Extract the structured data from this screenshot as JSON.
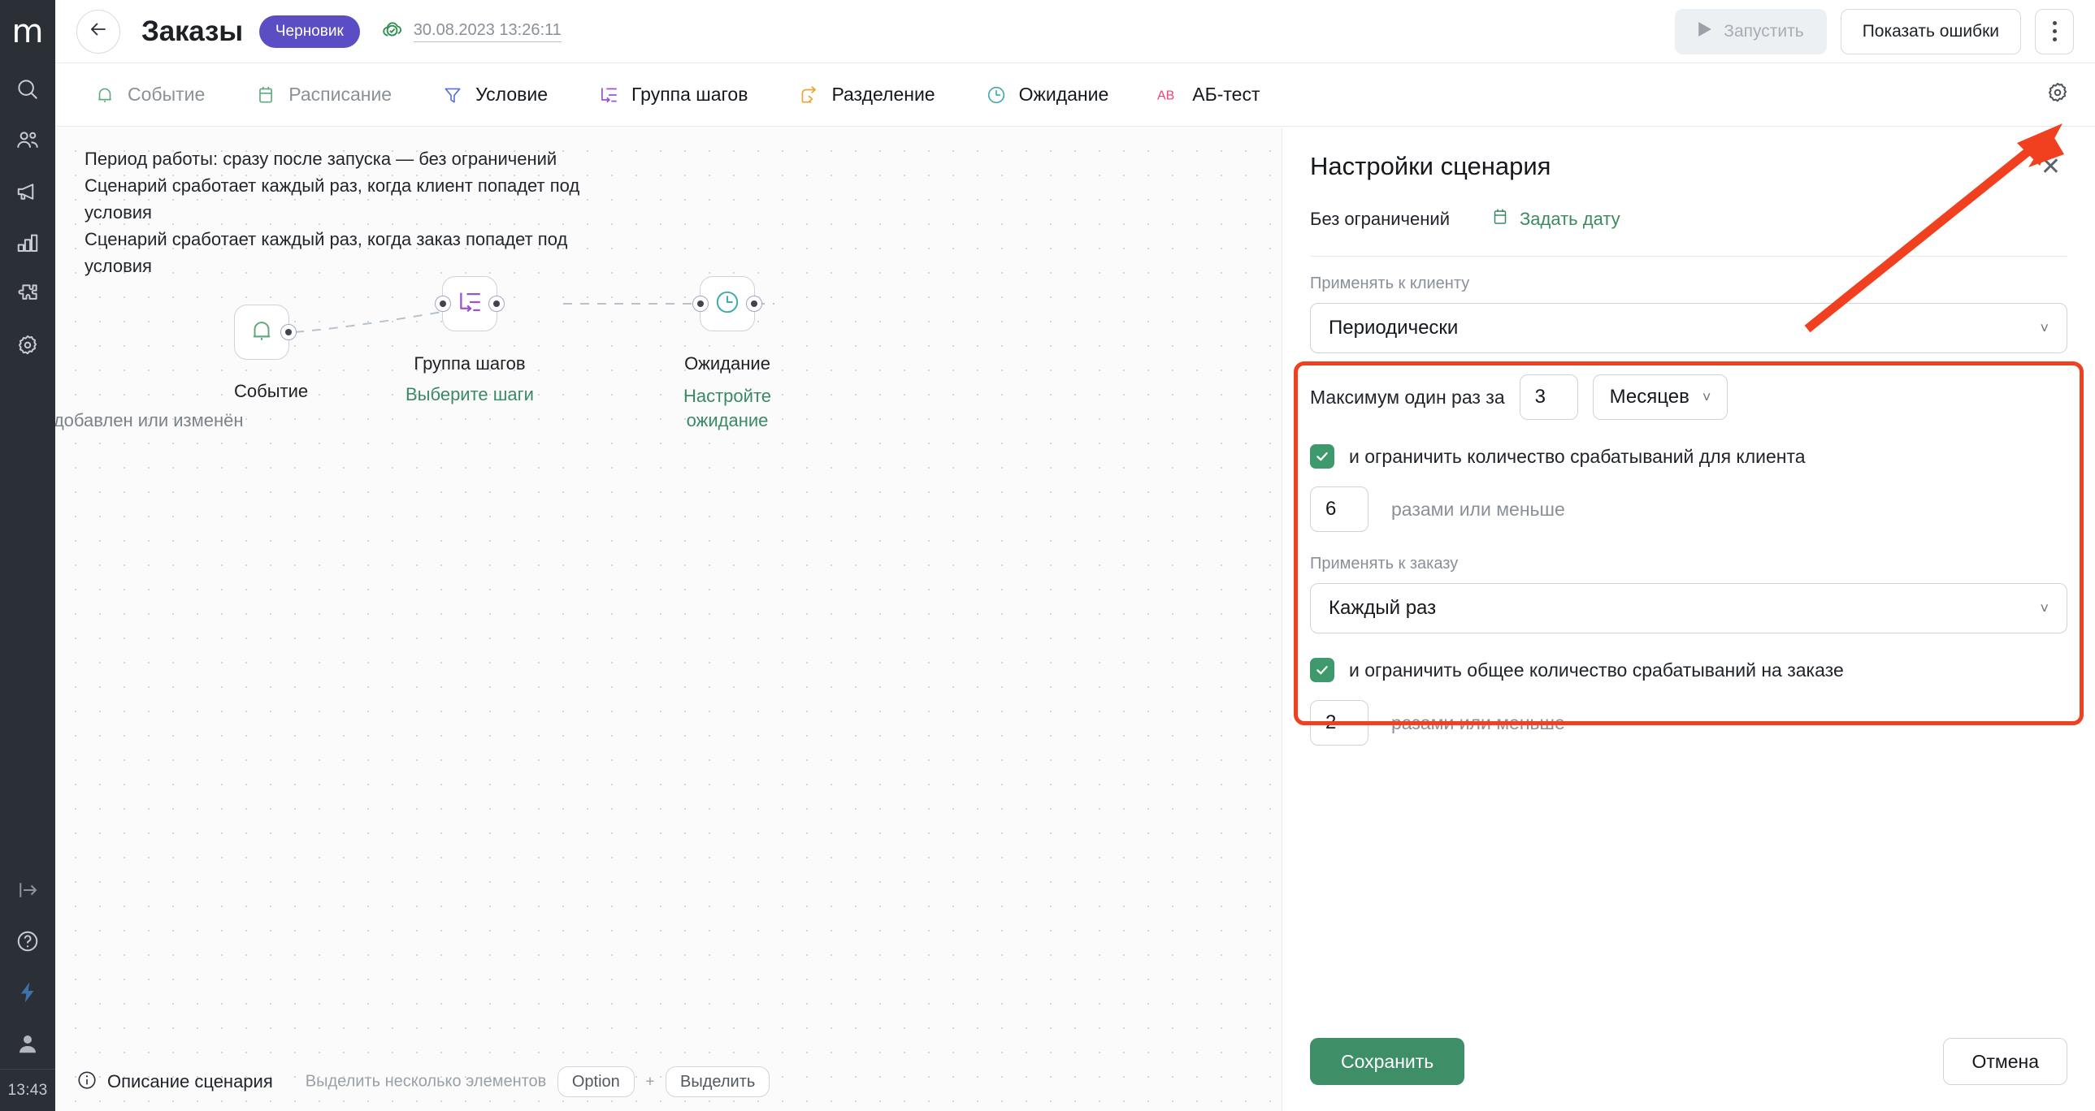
{
  "sidebar": {
    "logo": "m",
    "items": [
      {
        "name": "search",
        "label": "Поиск"
      },
      {
        "name": "clients",
        "label": "Клиенты"
      },
      {
        "name": "campaigns",
        "label": "Рассылки"
      },
      {
        "name": "analytics",
        "label": "Аналитика"
      },
      {
        "name": "integrations",
        "label": "Интеграции"
      },
      {
        "name": "settings",
        "label": "Настройки"
      }
    ],
    "bottom_items": [
      {
        "name": "logout",
        "label": "Выход"
      },
      {
        "name": "help",
        "label": "Помощь"
      },
      {
        "name": "automation",
        "label": "Автоматизация"
      },
      {
        "name": "account",
        "label": "Аккаунт"
      }
    ],
    "clock": "13:43"
  },
  "topbar": {
    "back_label": "Назад",
    "title": "Заказы",
    "status_badge": "Черновик",
    "saved_time": "30.08.2023 13:26:11",
    "run_label": "Запустить",
    "errors_label": "Показать ошибки",
    "more_label": "Ещё"
  },
  "toolbar": {
    "tools": [
      {
        "label": "Событие",
        "icon": "bell-icon",
        "color": "#5fa97d",
        "muted": true
      },
      {
        "label": "Расписание",
        "icon": "calendar-icon",
        "color": "#5fa97d",
        "muted": true
      },
      {
        "label": "Условие",
        "icon": "filter-icon",
        "color": "#5571d6",
        "muted": false
      },
      {
        "label": "Группа шагов",
        "icon": "steps-icon",
        "color": "#9b54c9",
        "muted": false
      },
      {
        "label": "Разделение",
        "icon": "split-icon",
        "color": "#eba43c",
        "muted": false
      },
      {
        "label": "Ожидание",
        "icon": "clock-icon",
        "color": "#3fabab",
        "muted": false
      },
      {
        "label": "АБ-тест",
        "icon": "ab-icon",
        "color": "#e8447f",
        "muted": false
      }
    ],
    "gear_label": "Настройки сценария"
  },
  "canvas": {
    "description_lines": [
      "Период работы: сразу после запуска — без ограничений",
      "Сценарий сработает каждый раз, когда клиент попадет под условия",
      "Сценарий сработает каждый раз, когда заказ попадет под условия"
    ],
    "nodes": [
      {
        "id": "event",
        "title": "Событие",
        "subtitle": "Заказ добавлен или изменён",
        "sub_is_link": false,
        "icon": "bell-icon",
        "color": "#5fa97d"
      },
      {
        "id": "group",
        "title": "Группа шагов",
        "subtitle": "Выберите шаги",
        "sub_is_link": true,
        "icon": "steps-icon",
        "color": "#9b54c9"
      },
      {
        "id": "wait",
        "title": "Ожидание",
        "subtitle": "Настройте ожидание",
        "sub_is_link": true,
        "icon": "clock-icon",
        "color": "#3fabab"
      }
    ],
    "footer": {
      "description_label": "Описание сценария",
      "hint": "Выделить несколько элементов",
      "key_option": "Option",
      "key_plus": "+",
      "key_select": "Выделить"
    }
  },
  "panel": {
    "title": "Настройки сценария",
    "close_label": "Закрыть",
    "period_label": "Без ограничений",
    "set_date_label": "Задать дату",
    "client_field": {
      "label": "Применять к клиенту",
      "value": "Периодически"
    },
    "frequency": {
      "label": "Максимум один раз за",
      "amount": "3",
      "unit": "Месяцев"
    },
    "client_limit": {
      "checked": true,
      "label": "и ограничить количество срабатываний для клиента",
      "value": "6",
      "suffix": "разами или меньше"
    },
    "order_field": {
      "label": "Применять к заказу",
      "value": "Каждый раз"
    },
    "order_limit": {
      "checked": true,
      "label": "и ограничить общее количество срабатываний на заказе",
      "value": "2",
      "suffix": "разами или меньше"
    },
    "save_label": "Сохранить",
    "cancel_label": "Отмена"
  },
  "colors": {
    "accent_green": "#3e8f68",
    "brand_purple": "#5b4ec4",
    "annotation_red": "#f04020",
    "rail_bg": "#2b2f36"
  }
}
